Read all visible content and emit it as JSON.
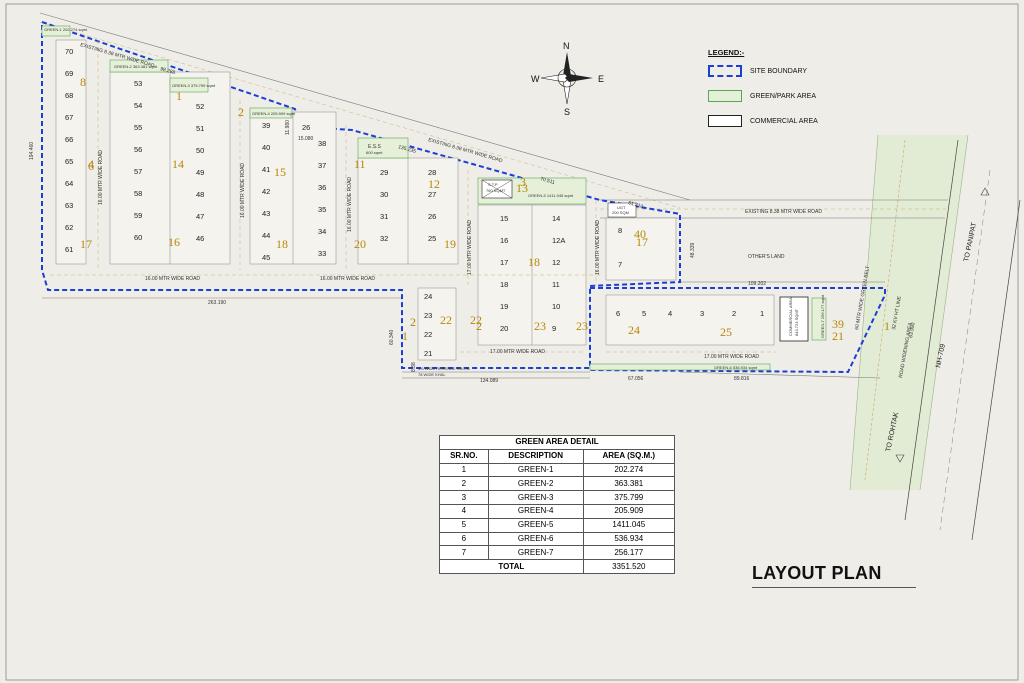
{
  "legend": {
    "title": "LEGEND:-",
    "items": [
      {
        "label": "SITE BOUNDARY",
        "style": "dashed-blue",
        "color": "#1a3fd6"
      },
      {
        "label": "GREEN/PARK AREA",
        "style": "green-box",
        "color": "#5aa55a"
      },
      {
        "label": "COMMERCIAL AREA",
        "style": "black-box",
        "color": "#222222"
      }
    ]
  },
  "compass": {
    "n": "N",
    "s": "S",
    "e": "E",
    "w": "W"
  },
  "roads": {
    "existing_1": "EXISTING 8.38 MTR WIDE ROAD",
    "existing_2": "EXISTING 8.38 MTR WIDE ROAD",
    "existing_3": "EXISTING 8.38 MTR WIDE ROAD",
    "r16_1": "16.00 MTR WIDE ROAD",
    "r16_2": "16.00 MTR WIDE ROAD",
    "r16_3": "16.00 MTR WIDE ROAD",
    "r16_4": "16.00 MTR WIDE ROAD",
    "r16_5": "16.00 MTR WIDE ROAD",
    "r16_6": "16.00 MTR WIDE ROAD",
    "r17_1": "17.00 MTR WIDE ROAD",
    "r17_2": "17.00 MTR WIDE ROAD",
    "r17_3": "17.00 MTR WIDE ROAD",
    "green_belt": "60 MTR WIDE GREEN BELT",
    "ht_line": "32 KV HT LINE",
    "widening": "ROAD WIDENING AREA",
    "nh": "NH-709",
    "to_panipat": "TO PANIPAT",
    "to_rohtak": "TO ROHTAK",
    "others_land": "OTHER'S LAND",
    "revenue_rasta": "3.6 WIDE REVENUE RASTA",
    "khal": "78 WIDE KHAL"
  },
  "dims": {
    "d1": "194.460",
    "d2": "263.190",
    "d3": "135.235",
    "d4": "70.511",
    "d5": "61.210",
    "d6": "48.339",
    "d7": "109.202",
    "d8": "134.089",
    "d9": "67.056",
    "d10": "89.816",
    "d11": "60.340",
    "d12": "8.38",
    "d13": "15.080",
    "d14": "11.980",
    "d15": "63.990",
    "d16": "98.288"
  },
  "plots": {
    "c1": [
      "70",
      "69",
      "68",
      "67",
      "66",
      "65",
      "64",
      "63",
      "62",
      "61"
    ],
    "c2": [
      "53",
      "54",
      "55",
      "56",
      "57",
      "58",
      "59",
      "60"
    ],
    "c3": [
      "52",
      "51",
      "50",
      "49",
      "48",
      "47",
      "46"
    ],
    "c4": [
      "39",
      "40",
      "41",
      "42",
      "43",
      "44",
      "45"
    ],
    "c5": [
      "38",
      "37",
      "36",
      "35",
      "34",
      "33"
    ],
    "c6": [
      "29",
      "30",
      "31",
      "32"
    ],
    "c7": [
      "28",
      "27",
      "26",
      "25"
    ],
    "c8": [
      "15",
      "16",
      "17",
      "18",
      "19",
      "20"
    ],
    "c9": [
      "14",
      "12A",
      "12",
      "11",
      "10",
      "9"
    ],
    "c10": [
      "24",
      "23",
      "22",
      "21"
    ],
    "c11": [
      "8",
      "7"
    ],
    "c12": [
      "6",
      "5",
      "4",
      "3",
      "2",
      "1"
    ],
    "p26": "26"
  },
  "blocks": [
    "8",
    "14",
    "15",
    "16",
    "17",
    "18",
    "11",
    "12",
    "20",
    "19",
    "13",
    "18",
    "40",
    "17",
    "24",
    "25",
    "39",
    "21",
    "22",
    "22",
    "23",
    "23",
    "2",
    "1",
    "4",
    "2",
    "6",
    "3",
    "1",
    "2",
    "1"
  ],
  "labels": {
    "green1": "GREEN-1 202.274 sqmt",
    "green2": "GREEN-2 363.381 sqmt",
    "green3": "GREEN-3 375.799 sqmt",
    "green4": "GREEN-4 205.909 sqmt",
    "green5": "GREEN-5 1411.045 sqmt",
    "green6": "GREEN-6 536.934 sqmt",
    "green7": "GREEN-7 256.177 sqmt",
    "es": "E.S.S",
    "es_area": "600 sqmt",
    "stp": "S.T.P",
    "stp_area": "760 SQMT",
    "ugt": "UGT",
    "ugt_area": "200 SQM",
    "commercial": "COMMERCIAL AREA",
    "commercial_area": "843.723 SQMT"
  },
  "table": {
    "title": "GREEN AREA DETAIL",
    "headers": [
      "SR.NO.",
      "DESCRIPTION",
      "AREA (SQ.M.)"
    ],
    "rows": [
      [
        "1",
        "GREEN-1",
        "202.274"
      ],
      [
        "2",
        "GREEN-2",
        "363.381"
      ],
      [
        "3",
        "GREEN-3",
        "375.799"
      ],
      [
        "4",
        "GREEN-4",
        "205.909"
      ],
      [
        "5",
        "GREEN-5",
        "1411.045"
      ],
      [
        "6",
        "GREEN-6",
        "536.934"
      ],
      [
        "7",
        "GREEN-7",
        "256.177"
      ]
    ],
    "total_label": "TOTAL",
    "total_value": "3351.520"
  },
  "title": "LAYOUT PLAN"
}
